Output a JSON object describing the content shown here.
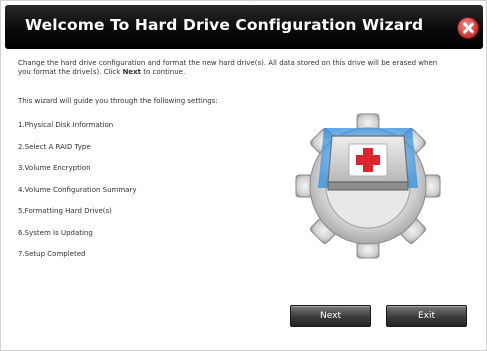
{
  "dialog": {
    "title": "Welcome To Hard Drive Configuration Wizard",
    "intro_part1": "Change the hard drive configuration and format the new hard drive(s). All data stored on this drive will be erased when you format the drive(s). Click ",
    "intro_bold": "Next",
    "intro_part2": " to continue.",
    "guide": "This wizard will guide you through the following settings:",
    "steps": [
      "1.Physical Disk Information",
      "2.Select A RAID Type",
      "3.Volume Encryption",
      "4.Volume Configuration Summary",
      "5.Formatting Hard Drive(s)",
      "6.System Is Updating",
      "7.Setup Completed"
    ]
  },
  "buttons": {
    "next": "Next",
    "exit": "Exit"
  },
  "colors": {
    "titlebar": "#000000",
    "close": "#d43b3b",
    "cross": "#e0232e",
    "gear": "#c9c9c9"
  },
  "icons": {
    "close": "close-icon",
    "illustration": "hard-drive-gear-icon"
  }
}
